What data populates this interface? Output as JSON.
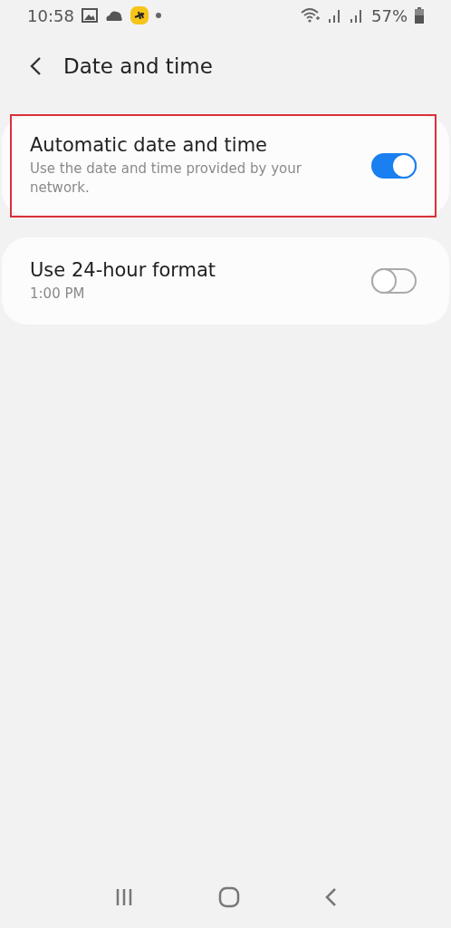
{
  "status_bar": {
    "time": "10:58",
    "battery": "57%"
  },
  "header": {
    "title": "Date and time"
  },
  "settings": [
    {
      "title": "Automatic date and time",
      "summary": "Use the date and time provided by your network.",
      "on": true,
      "highlighted": true
    },
    {
      "title": "Use 24-hour format",
      "summary": "1:00 PM",
      "on": false,
      "highlighted": false
    }
  ]
}
